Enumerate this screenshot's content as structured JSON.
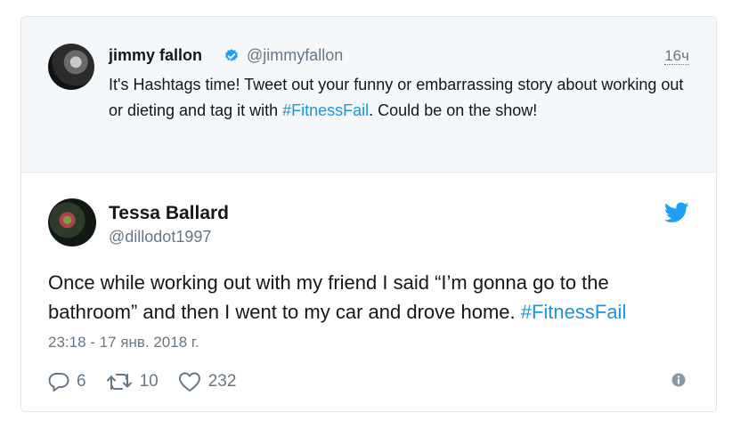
{
  "quoted": {
    "name": "jimmy fallon",
    "handle": "@jimmyfallon",
    "time": "16ч",
    "text_before": "It's Hashtags time! Tweet out your funny or embarrassing story about working out or dieting and tag it with ",
    "hashtag": "#FitnessFail",
    "text_after": ". Could be on the show!"
  },
  "tweet": {
    "name": "Tessa Ballard",
    "handle": "@dillodot1997",
    "text_before": "Once while working out with my friend I said “I’m gonna go to the bathroom” and then I went to my car and drove home. ",
    "hashtag": "#FitnessFail",
    "date": "23:18 - 17 янв. 2018 г."
  },
  "actions": {
    "replies": "6",
    "retweets": "10",
    "likes": "232"
  },
  "colors": {
    "link": "#1b95e0",
    "muted": "#657786",
    "quoted_bg": "#f5f8fa"
  },
  "icons": [
    "verified-icon",
    "twitter-bird-icon",
    "reply-icon",
    "retweet-icon",
    "like-icon",
    "info-icon"
  ]
}
